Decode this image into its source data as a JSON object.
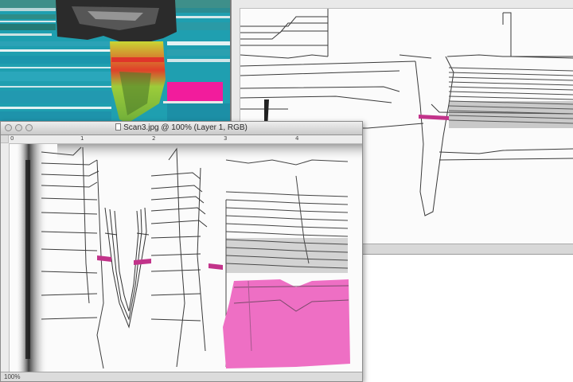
{
  "colors": {
    "cyan_map": "#1f9fb0",
    "heat_green": "#8ec63f",
    "heat_red": "#d8342a",
    "magenta_fill": "#ee6fc4",
    "dark_band": "#2b2b2b",
    "pink_marker": "#c2338a"
  },
  "front_window": {
    "title": "Scan3.jpg @ 100% (Layer 1, RGB)",
    "icon": "document-icon",
    "ruler_ticks": [
      "0",
      "1",
      "2",
      "3",
      "4"
    ],
    "status_zoom": "100%"
  },
  "right_window": {
    "icon": "document-icon"
  },
  "left_window": {
    "content": "false-color layer visualization"
  }
}
